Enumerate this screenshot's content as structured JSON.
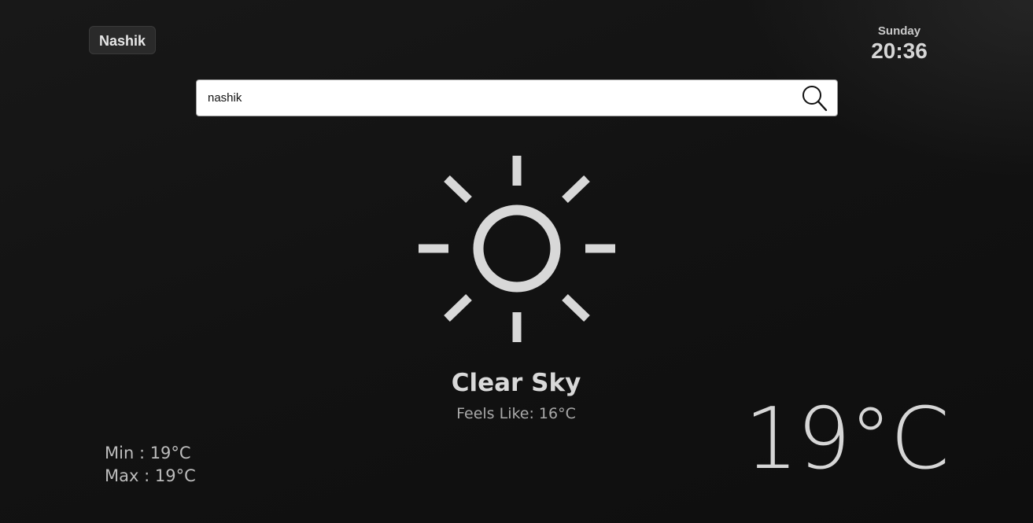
{
  "location": {
    "city_label": "Nashik"
  },
  "clock": {
    "day": "Sunday",
    "time": "20:36"
  },
  "search": {
    "value": "nashik",
    "icon": "search-icon"
  },
  "weather": {
    "icon": "sun-icon",
    "condition": "Clear Sky",
    "feels_like": "Feels Like: 16°C",
    "min": "Min : 19°C",
    "max": "Max : 19°C",
    "temperature": "19°C"
  },
  "colors": {
    "background": "#141414",
    "text": "#d8d8d8",
    "icon": "#d8d8d8"
  }
}
